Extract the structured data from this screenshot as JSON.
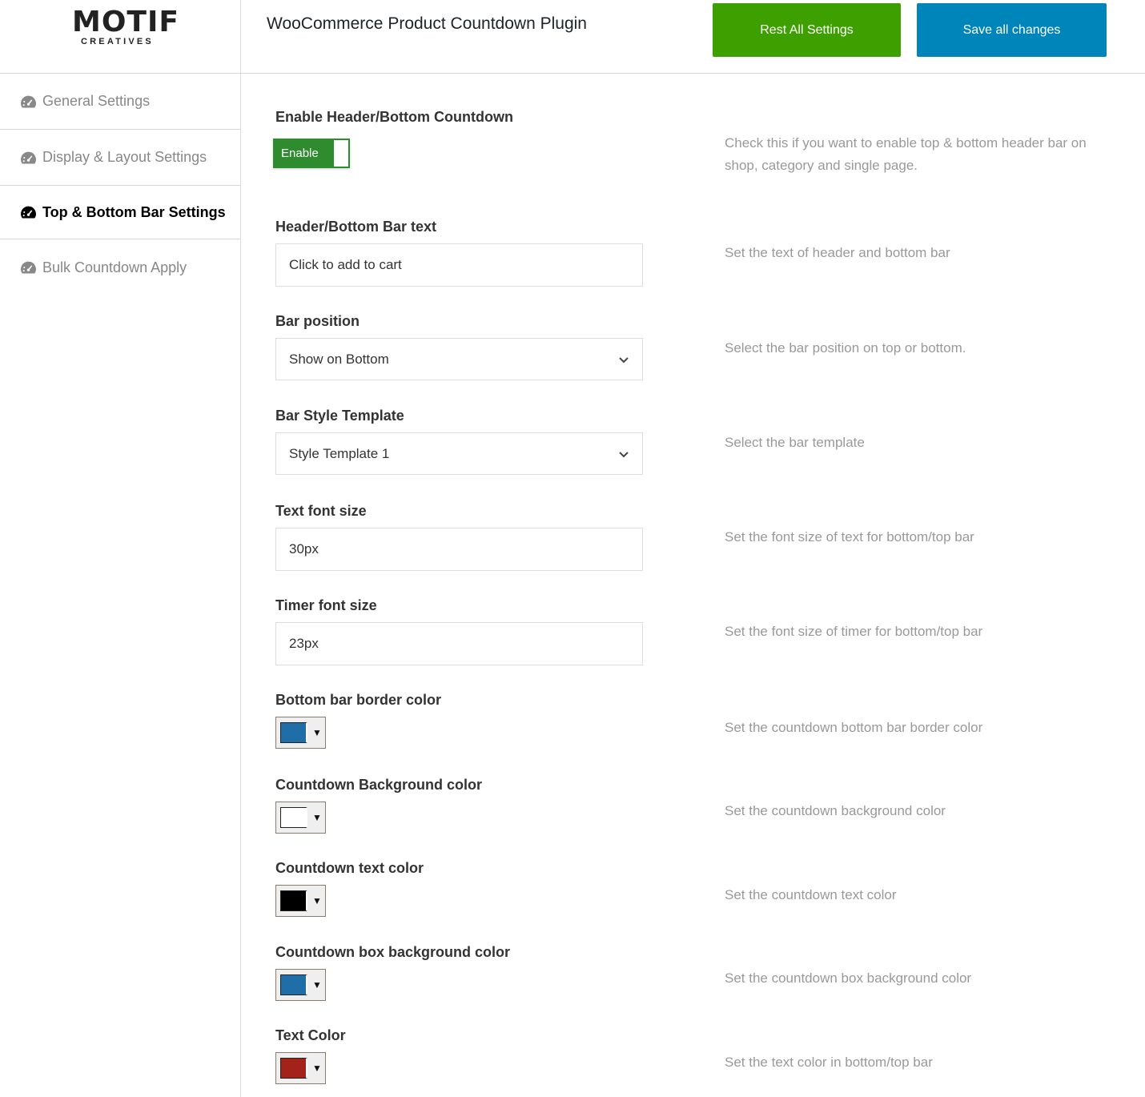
{
  "logo": {
    "main": "MOTIF",
    "sub": "CREATIVES"
  },
  "header": {
    "title": "WooCommerce Product Countdown Plugin",
    "reset_label": "Rest All Settings",
    "save_label": "Save all changes"
  },
  "colors": {
    "reset": "#3ea000",
    "save": "#0085ba",
    "toggle": "#2e8b2e"
  },
  "sidebar": {
    "items": [
      {
        "label": "General Settings",
        "icon": "dashboard-icon",
        "active": false
      },
      {
        "label": "Display & Layout Settings",
        "icon": "dashboard-icon",
        "active": false
      },
      {
        "label": "Top & Bottom Bar Settings",
        "icon": "dashboard-icon",
        "active": true
      },
      {
        "label": "Bulk Countdown Apply",
        "icon": "dashboard-icon",
        "active": false
      }
    ]
  },
  "fields": {
    "enable": {
      "label": "Enable Header/Bottom Countdown",
      "toggle_label": "Enable",
      "help": "Check this if you want to enable top & bottom header bar on shop, category and single page."
    },
    "bar_text": {
      "label": "Header/Bottom Bar text",
      "value": "Click to add to cart",
      "help": "Set the text of header and bottom bar"
    },
    "bar_position": {
      "label": "Bar position",
      "value": "Show on Bottom",
      "help": "Select the bar position on top or bottom."
    },
    "bar_style": {
      "label": "Bar Style Template",
      "value": "Style Template 1",
      "help": "Select the bar template"
    },
    "text_font_size": {
      "label": "Text font size",
      "value": "30px",
      "help": "Set the font size of text for bottom/top bar"
    },
    "timer_font_size": {
      "label": "Timer font size",
      "value": "23px",
      "help": "Set the font size of timer for bottom/top bar"
    },
    "border_color": {
      "label": "Bottom bar border color",
      "color": "#1f6ea8",
      "help": "Set the countdown bottom bar border color"
    },
    "bg_color": {
      "label": "Countdown Background color",
      "color": "#ffffff",
      "help": "Set the countdown background color"
    },
    "text_color": {
      "label": "Countdown text color",
      "color": "#000000",
      "help": "Set the countdown text color"
    },
    "box_bg_color": {
      "label": "Countdown box background color",
      "color": "#1f6ea8",
      "help": "Set the countdown box background color"
    },
    "bar_text_color": {
      "label": "Text Color",
      "color": "#a3231a",
      "help": "Set the text color in bottom/top bar"
    }
  }
}
